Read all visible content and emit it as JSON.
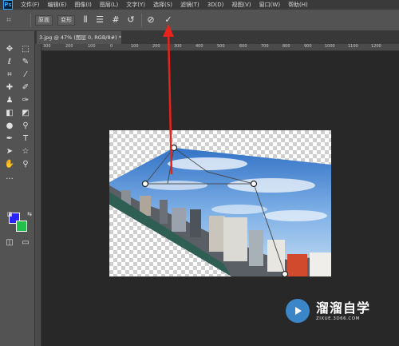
{
  "app": {
    "logo_text": "Ps",
    "menu": [
      "文件(F)",
      "编辑(E)",
      "图像(I)",
      "图层(L)",
      "文字(Y)",
      "选择(S)",
      "滤镜(T)",
      "3D(D)",
      "视图(V)",
      "窗口(W)",
      "帮助(H)"
    ]
  },
  "options_bar": {
    "tool_icon": "transform-icon",
    "mode_button_1": "原面",
    "mode_button_2": "变形",
    "icons": [
      "warp-grid-icon",
      "split-horizontal-icon",
      "grid-icon",
      "reset-icon",
      "cancel-icon",
      "commit-checkmark-icon"
    ]
  },
  "document": {
    "tab_title": "3.jpg @ 47% (图层 0, RGB/8#) *",
    "close_label": "×"
  },
  "ruler": {
    "marks": [
      "300",
      "200",
      "100",
      "0",
      "100",
      "200",
      "300",
      "400",
      "500",
      "600",
      "700",
      "800",
      "900",
      "1000",
      "1100",
      "1200"
    ]
  },
  "toolbox": {
    "extra": "..."
  },
  "colors": {
    "foreground": "#2a22ff",
    "background": "#22c04a",
    "annotation_arrow": "#e8231c"
  },
  "watermark": {
    "title": "溜溜自学",
    "url": "ZIXUE.3D66.COM"
  }
}
